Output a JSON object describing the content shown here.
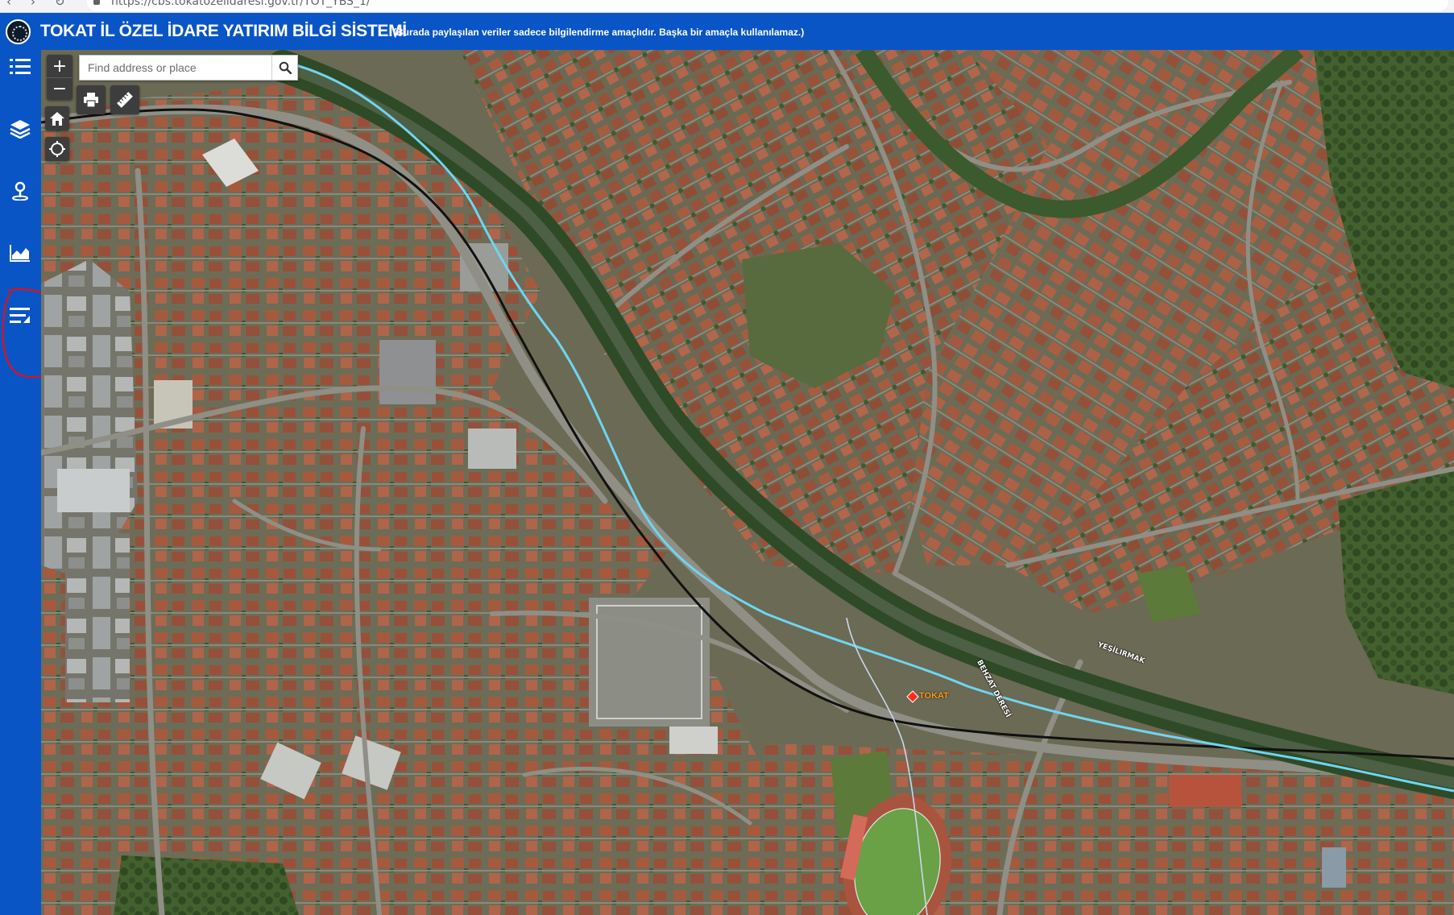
{
  "browser": {
    "url": "https://cbs.tokatozelidaresi.gov.tr/TOT_YBS_1/",
    "back_glyph": "‹",
    "forward_glyph": "›",
    "reload_glyph": "↻"
  },
  "header": {
    "title": "TOKAT İL ÖZEL İDARE YATIRIM BİLGİ SİSTEMİ",
    "note": "(Burada paylaşılan veriler sadece bilgilendirme amaçlıdır. Başka bir amaçla kullanılamaz.)",
    "logo_icon": "emblem-seal"
  },
  "sidebar": {
    "items": [
      {
        "name": "list-icon"
      },
      {
        "name": "layers-icon"
      },
      {
        "name": "location-pin-icon"
      },
      {
        "name": "area-chart-icon"
      },
      {
        "name": "menu-lines-icon"
      }
    ],
    "annotation_color": "#e0101b"
  },
  "map": {
    "zoom_in": "+",
    "zoom_out": "−",
    "search_placeholder": "Find address or place",
    "river_label": "YEŞİLIRMAK",
    "stream_label": "BEHZAT DERESİ",
    "city_label": "TOKAT",
    "colors": {
      "river": "#6fd5f0",
      "rail": "#111111",
      "roof": "#a55a3e",
      "vegetation": "#3f5a2c",
      "ground": "#6b6a55"
    }
  }
}
